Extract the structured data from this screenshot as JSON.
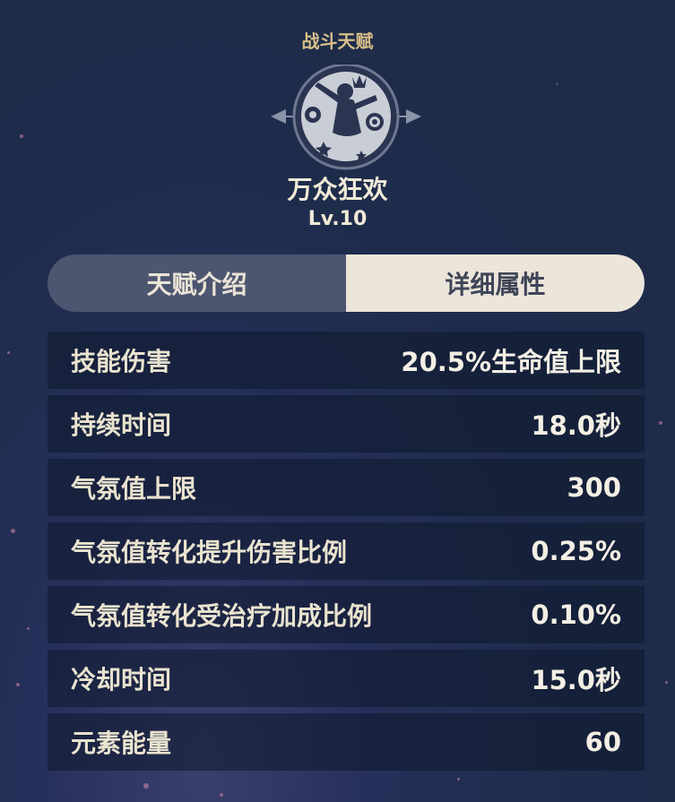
{
  "header": {
    "title": "战斗天赋"
  },
  "talent": {
    "icon": "dancer-celebration-icon",
    "name": "万众狂欢",
    "level": "Lv.10"
  },
  "tabs": [
    {
      "label": "天赋介绍",
      "active": false
    },
    {
      "label": "详细属性",
      "active": true
    }
  ],
  "stats": [
    {
      "label": "技能伤害",
      "value": "20.5%生命值上限"
    },
    {
      "label": "持续时间",
      "value": "18.0秒"
    },
    {
      "label": "气氛值上限",
      "value": "300"
    },
    {
      "label": "气氛值转化提升伤害比例",
      "value": "0.25%"
    },
    {
      "label": "气氛值转化受治疗加成比例",
      "value": "0.10%"
    },
    {
      "label": "冷却时间",
      "value": "15.0秒"
    },
    {
      "label": "元素能量",
      "value": "60"
    }
  ],
  "colors": {
    "header_gold": "#d8bf8a",
    "tab_active_bg": "#ece5da",
    "tab_inactive_bg": "#4d5670",
    "background": "#1e2c4c"
  }
}
